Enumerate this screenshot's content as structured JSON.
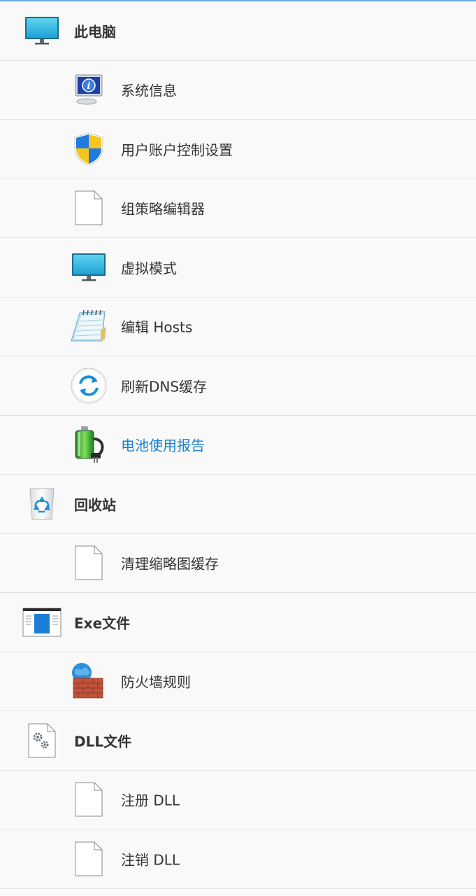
{
  "items": [
    {
      "label": "此电脑",
      "icon": "monitor-icon"
    },
    {
      "label": "系统信息",
      "icon": "system-info-icon"
    },
    {
      "label": "用户账户控制设置",
      "icon": "uac-shield-icon"
    },
    {
      "label": "组策略编辑器",
      "icon": "blank-file-icon"
    },
    {
      "label": "虚拟模式",
      "icon": "monitor-icon"
    },
    {
      "label": "编辑 Hosts",
      "icon": "notepad-icon"
    },
    {
      "label": "刷新DNS缓存",
      "icon": "refresh-icon"
    },
    {
      "label": "电池使用报告",
      "icon": "battery-icon"
    },
    {
      "label": "回收站",
      "icon": "recycle-bin-icon"
    },
    {
      "label": "清理缩略图缓存",
      "icon": "blank-file-icon"
    },
    {
      "label": "Exe文件",
      "icon": "exe-window-icon"
    },
    {
      "label": "防火墙规则",
      "icon": "firewall-icon"
    },
    {
      "label": "DLL文件",
      "icon": "dll-gear-file-icon"
    },
    {
      "label": "注册 DLL",
      "icon": "blank-file-icon"
    },
    {
      "label": "注销 DLL",
      "icon": "blank-file-icon"
    }
  ],
  "colors": {
    "active_text": "#1a7fd1",
    "text": "#333333",
    "background": "#f9f9f9",
    "divider": "#e3e3e3"
  }
}
